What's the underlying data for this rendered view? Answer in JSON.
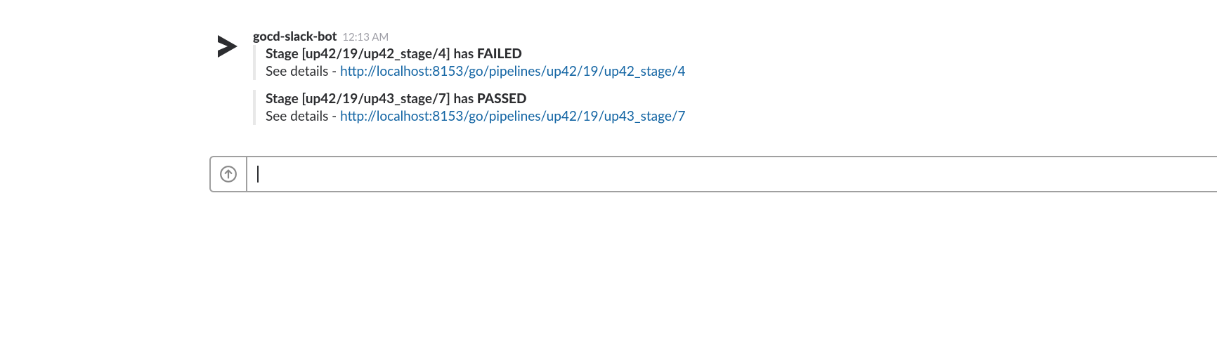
{
  "message": {
    "username": "gocd-slack-bot",
    "timestamp": "12:13 AM",
    "attachments": [
      {
        "title_prefix": "Stage [up42/19/up42_stage/4] has ",
        "title_status": "FAILED",
        "detail_prefix": "See details - ",
        "detail_link": "http://localhost:8153/go/pipelines/up42/19/up42_stage/4"
      },
      {
        "title_prefix": "Stage [up42/19/up43_stage/7] has ",
        "title_status": "PASSED",
        "detail_prefix": "See details - ",
        "detail_link": "http://localhost:8153/go/pipelines/up42/19/up43_stage/7"
      }
    ]
  }
}
